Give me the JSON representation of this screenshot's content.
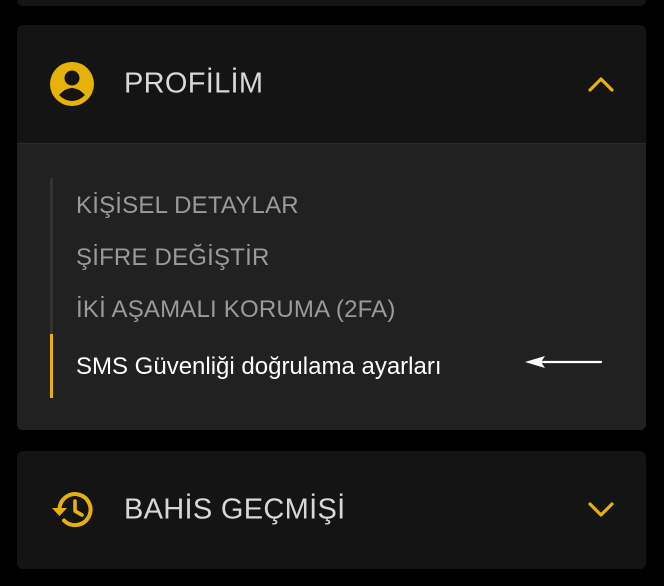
{
  "profile_section": {
    "title": "PROFİLİM",
    "icon": "account-circle-icon",
    "chevron": "chevron-up-icon",
    "expanded": true,
    "menu_items": [
      {
        "label": "KİŞİSEL DETAYLAR",
        "active": false
      },
      {
        "label": "ŞİFRE DEĞİŞTİR",
        "active": false
      },
      {
        "label": "İKİ AŞAMALI KORUMA (2FA)",
        "active": false
      },
      {
        "label": "SMS Güvenliği doğrulama ayarları",
        "active": true
      }
    ]
  },
  "history_section": {
    "title": "BAHİS GEÇMİŞİ",
    "icon": "history-icon",
    "chevron": "chevron-down-icon",
    "expanded": false
  },
  "annotation": {
    "icon": "left-arrow-annotation-icon"
  },
  "colors": {
    "accent": "#e6b20a",
    "panel_bg": "#141414",
    "submenu_bg": "#212121",
    "text_muted": "#9a9a9a",
    "text_header": "#d8d8d8",
    "text_active": "#ffffff"
  }
}
